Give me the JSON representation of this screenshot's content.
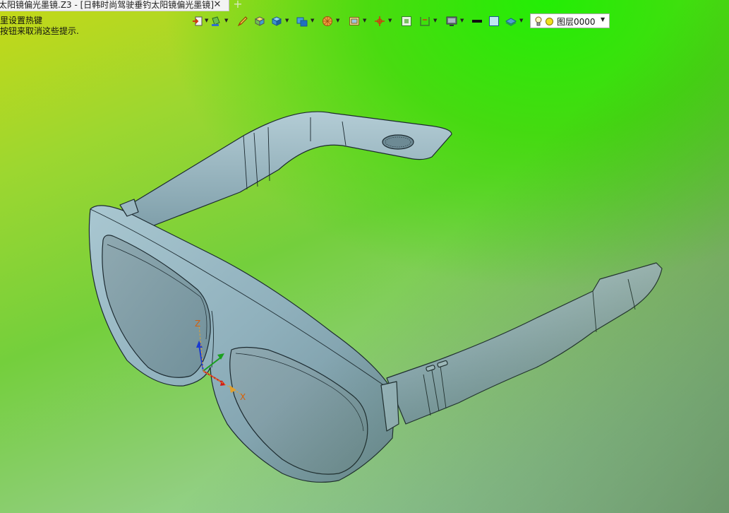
{
  "tab": {
    "title": "太阳镜偏光墨镜.Z3 - [日韩时尚驾驶垂钓太阳镜偏光墨镜]",
    "close_glyph": "✕",
    "add_glyph": "+"
  },
  "hint": {
    "line1": "里设置热键",
    "line2": "按钮来取消这些提示."
  },
  "toolbar": {
    "icons": [
      "import-icon",
      "fill-icon",
      "sketch-pencil-icon",
      "solid-box-icon",
      "shaded-cube-icon",
      "display-mode-icon",
      "render-sphere-icon",
      "view-frame-icon",
      "move-axes-icon",
      "fit-view-icon",
      "section-icon",
      "monitor-icon",
      "line-color-swatch",
      "fill-color-swatch",
      "layer-manager-icon"
    ],
    "layer_label": "图层0000"
  },
  "viewport": {
    "axis_labels": {
      "x": "X",
      "y": "Y",
      "z": "Z"
    }
  },
  "colors": {
    "model": "#8fb3bf",
    "model_edge": "#1c2a30",
    "lens": "#7f9fa9"
  }
}
